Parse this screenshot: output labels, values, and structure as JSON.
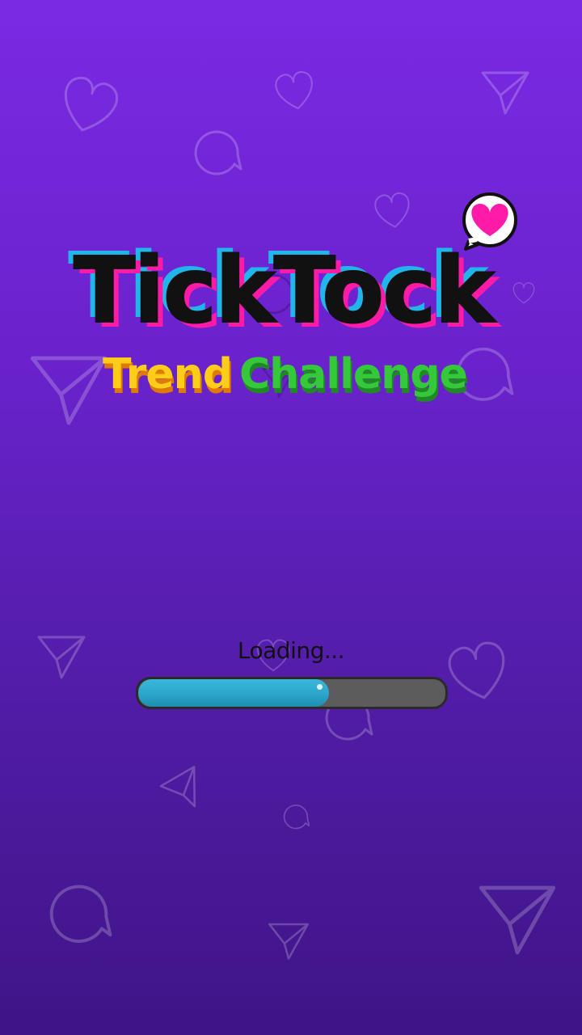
{
  "game": {
    "title_part1": "Tick",
    "title_part2": "Tock",
    "subtitle_part1": "Trend",
    "subtitle_part2": "Challenge"
  },
  "loading": {
    "label": "Loading...",
    "progress": 0.62
  },
  "colors": {
    "background_top": "#7a2ae3",
    "background_bottom": "#3f1487",
    "title_fill": "#111111",
    "title_shadow_cyan": "#22b5ea",
    "title_shadow_magenta": "#ff1aa8",
    "subtitle_trend": "#ffcc1a",
    "subtitle_challenge": "#35c83a",
    "heart_bubble": "#ff1aa8",
    "progress_fill": "#2aa3c9",
    "progress_track": "#5c5c5c"
  }
}
